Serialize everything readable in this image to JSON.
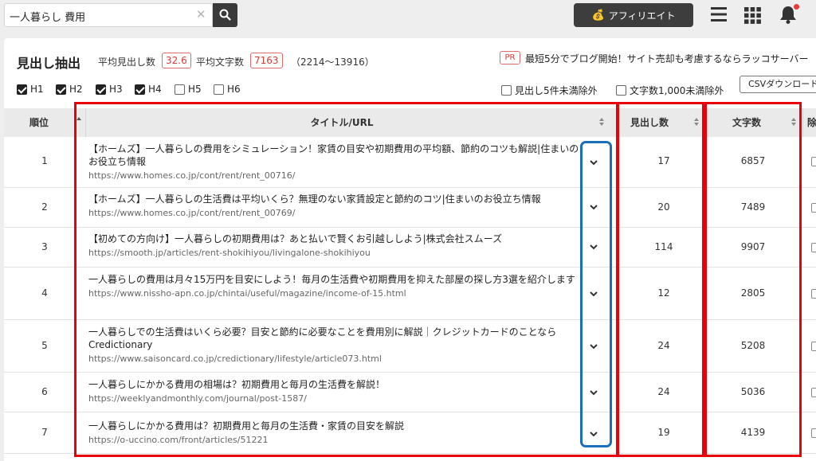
{
  "search": {
    "value": "一人暮らし 費用",
    "clear": "✕"
  },
  "header": {
    "affiliate_label": "アフィリエイト",
    "medal": "💰"
  },
  "page": {
    "title": "見出し抽出",
    "avg_headings_label": "平均見出し数",
    "avg_headings_value": "32.6",
    "avg_chars_label": "平均文字数",
    "avg_chars_value": "7163",
    "range": "（2214〜13916）",
    "pr_label": "PR",
    "pr_text": "最短5分でブログ開始！サイト売却も考慮するならラッコサーバー"
  },
  "filters": {
    "levels": [
      {
        "label": "H1",
        "checked": true
      },
      {
        "label": "H2",
        "checked": true
      },
      {
        "label": "H3",
        "checked": true
      },
      {
        "label": "H4",
        "checked": true
      },
      {
        "label": "H5",
        "checked": false
      },
      {
        "label": "H6",
        "checked": false
      }
    ],
    "exclude_few": "見出し5件未満除外",
    "exclude_short": "文字数1,000未満除外",
    "csv": "CSVダウンロード"
  },
  "table": {
    "headers": {
      "rank": "順位",
      "title": "タイトル/URL",
      "headings": "見出し数",
      "chars": "文字数",
      "exclude": "除"
    },
    "rows": [
      {
        "rank": "1",
        "title": "【ホームズ】一人暮らしの費用をシミュレーション！家賃の目安や初期費用の平均額、節約のコツも解説|住まいのお役立ち情報",
        "url": "https://www.homes.co.jp/cont/rent/rent_00716/",
        "headings": "17",
        "chars": "6857"
      },
      {
        "rank": "2",
        "title": "【ホームズ】一人暮らしの生活費は平均いくら？無理のない家賃設定と節約のコツ|住まいのお役立ち情報",
        "url": "https://www.homes.co.jp/cont/rent/rent_00769/",
        "headings": "20",
        "chars": "7489"
      },
      {
        "rank": "3",
        "title": "【初めての方向け】一人暮らしの初期費用は？あと払いで賢くお引越ししよう|株式会社スムーズ",
        "url": "https://smooth.jp/articles/rent-shokihiyou/livingalone-shokihiyou",
        "headings": "114",
        "chars": "9907"
      },
      {
        "rank": "4",
        "title": "一人暮らしの費用は月々15万円を目安にしよう！毎月の生活費や初期費用を抑えた部屋の探し方3選を紹介します",
        "url": "https://www.nissho-apn.co.jp/chintai/useful/magazine/income-of-15.html",
        "headings": "12",
        "chars": "2805"
      },
      {
        "rank": "5",
        "title": "一人暮らしでの生活費はいくら必要？目安と節約に必要なことを費用別に解説｜クレジットカードのことならCredictionary",
        "url": "https://www.saisoncard.co.jp/credictionary/lifestyle/article073.html",
        "headings": "24",
        "chars": "5208"
      },
      {
        "rank": "6",
        "title": "一人暮らしにかかる費用の相場は？初期費用と毎月の生活費を解説！",
        "url": "https://weeklyandmonthly.com/journal/post-1587/",
        "headings": "24",
        "chars": "5036"
      },
      {
        "rank": "7",
        "title": "一人暮らしにかかる費用は？初期費用と毎月の生活費・家賃の目安を解説",
        "url": "https://o-uccino.com/front/articles/51221",
        "headings": "19",
        "chars": "4139"
      }
    ]
  },
  "colors": {
    "highlight_red": "#e8000b",
    "highlight_blue": "#1b6fb8",
    "badge_red": "#d83a3a"
  }
}
